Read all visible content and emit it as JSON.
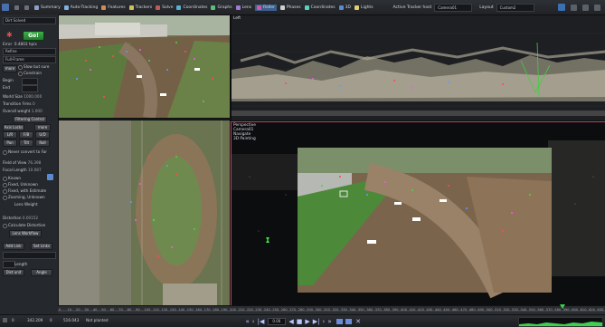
{
  "toolbar": {
    "items": [
      {
        "label": "Summary",
        "icon": "summary-icon",
        "color": "#8aa1c8"
      },
      {
        "label": "Auto-Tracking",
        "icon": "auto-tracking-icon",
        "color": "#7fb0e0"
      },
      {
        "label": "Features",
        "icon": "features-icon",
        "color": "#d08a5a"
      },
      {
        "label": "Trackers",
        "icon": "trackers-icon",
        "color": "#d0c05a"
      },
      {
        "label": "Solve",
        "icon": "solve-icon",
        "color": "#c05a5a"
      },
      {
        "label": "Coordinates",
        "icon": "coordinates-icon",
        "color": "#5ab0d0"
      },
      {
        "label": "Graphs",
        "icon": "graphs-icon",
        "color": "#5ac07a"
      },
      {
        "label": "Lens",
        "icon": "lens-icon",
        "color": "#a07ad0"
      },
      {
        "label": "Roller",
        "icon": "roller-icon",
        "color": "#d05aa0",
        "active": true
      },
      {
        "label": "Phases",
        "icon": "phases-icon",
        "color": "#d0d0d0"
      },
      {
        "label": "Coordinates",
        "icon": "coordinates-icon-2",
        "color": "#5ad0c0"
      },
      {
        "label": "3D",
        "icon": "3d-icon",
        "color": "#5a8ad0"
      },
      {
        "label": "Lights",
        "icon": "lights-icon",
        "color": "#e0d070"
      }
    ],
    "active_tracker_label": "Active Tracker host",
    "active_tracker_value": "Camera01",
    "layout_label": "Layout",
    "layout_value": "Custom2"
  },
  "left_panel": {
    "dropdown_top": "Dirt Solved",
    "go_label": "Go!",
    "error_label": "Error",
    "error_value": "0.4803 hpix",
    "mode_value": "Refine",
    "sub_value": "Full-Frame",
    "slow_but_sure": "Slow but sure",
    "constrain": "Constrain",
    "begin_label": "Begin",
    "end_label": "End",
    "world_size_label": "World Size",
    "world_size_value": "1000.000",
    "transition_frms_label": "Transition Frms",
    "transition_frms_value": "0",
    "overall_weight_label": "Overall weight",
    "overall_weight_value": "1.000",
    "filtering_control": "Filtering Control",
    "axis_locks_label": "Axis Locks",
    "more_label": "more",
    "lock_buttons": [
      "L/R",
      "F/B",
      "U/D",
      "Pan",
      "Tilt",
      "Roll"
    ],
    "never_convert": "Never convert to Far",
    "field_of_view_label": "Field of View",
    "field_of_view_value": "76.398",
    "focal_length_label": "Focal Length",
    "focal_length_value": "10.087",
    "known_opts": [
      "Known",
      "Fixed, Unknown",
      "Fixed, with Estimate",
      "Zooming, Unknown"
    ],
    "lens_weight_label": "Lens Weight",
    "distortion_label": "Distortion",
    "distortion_value": "0.00152",
    "calc_distortion": "Calculate Distortion",
    "lens_workflow": "Lens Workflow",
    "add_link": "Add Link",
    "set_links": "Set Links",
    "length_label": "Length",
    "dist_unit": "Dist unit",
    "angle_label": "Angle"
  },
  "viewports": {
    "camera_view": "",
    "left_view": "Left",
    "top_view": "",
    "perspective": "Perspective",
    "perspective_lines": [
      "Camera01",
      "Navigate",
      "3D Painting"
    ]
  },
  "timeline": {
    "ticks": [
      "0",
      "10",
      "20",
      "30",
      "40",
      "50",
      "60",
      "70",
      "80",
      "90",
      "100",
      "110",
      "120",
      "130",
      "140",
      "150",
      "160",
      "170",
      "180",
      "190",
      "200",
      "210",
      "220",
      "230",
      "240",
      "250",
      "260",
      "270",
      "280",
      "290",
      "300",
      "310",
      "320",
      "330",
      "340",
      "350",
      "360",
      "370",
      "380",
      "390",
      "400",
      "410",
      "420",
      "430",
      "440",
      "450",
      "460",
      "470",
      "480",
      "490",
      "500",
      "510",
      "520",
      "530",
      "540",
      "550",
      "560",
      "570",
      "580",
      "590",
      "600",
      "610",
      "620",
      "630"
    ],
    "frame_value": "0.00",
    "current_frame": "0"
  },
  "statusbar": {
    "left_fields": [
      "0",
      "342.209",
      "0",
      "516.043"
    ],
    "status_text": "Not planted",
    "frame_box": "0.00",
    "play_controls": [
      "«",
      "‹",
      "|◀",
      "◀",
      "■",
      "▶",
      "▶|",
      "›",
      "»"
    ],
    "extra_icons": [
      "loop-icon",
      "bounce-icon",
      "close-icon"
    ]
  }
}
